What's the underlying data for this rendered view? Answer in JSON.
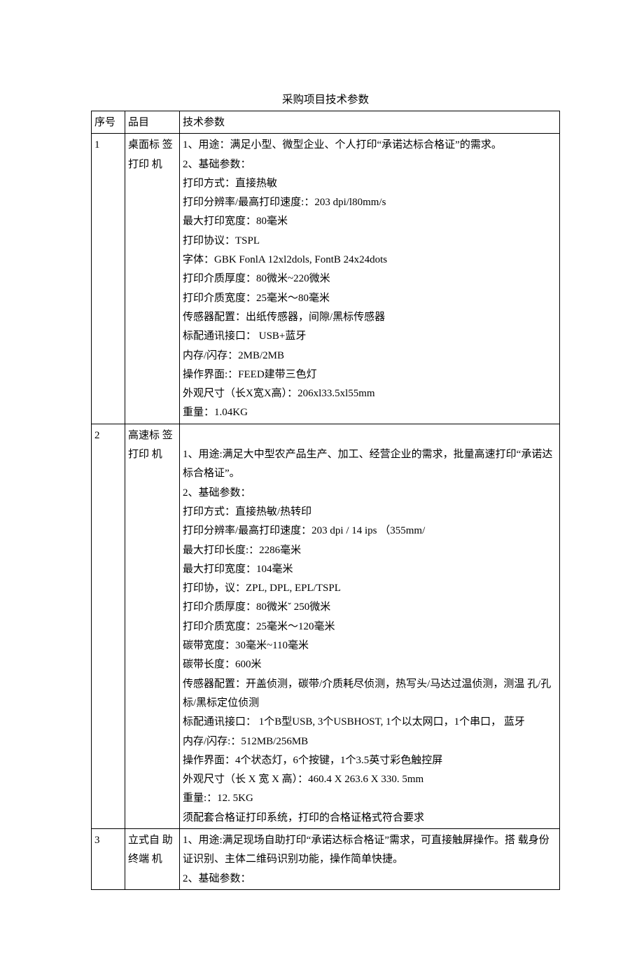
{
  "title": "采购项目技术参数",
  "header": {
    "col1": "序号",
    "col2": "品目",
    "col3": "技术参数"
  },
  "rows": [
    {
      "idx": "1",
      "name": "桌面标 签打印 机",
      "spec": [
        "1、用途：满足小型、微型企业、个人打印“承诺达标合格证”的需求。",
        "2、基础参数：",
        "打印方式：直接热敏",
        "打印分辨率/最高打印速度:：203 dpi/l80mm/s",
        "最大打印宽度：80毫米",
        "打印协议：TSPL",
        "字体：GBK FonlA 12xl2dols, FontB 24x24dots",
        "打印介质厚度：80微米~220微米",
        "打印介质宽度：25毫米～80毫米",
        "传感器配置：出纸传感器，间隙/黑标传感器",
        "标配通讯接口： USB+蓝牙",
        "内存/闪存：2MB/2MB",
        "操作界面:：FEED建带三色灯",
        "外观尺寸（长X宽X高）：206xl33.5xl55mm",
        "重量：1.04KG"
      ]
    },
    {
      "idx": "2",
      "name": "高速标 签打印 机",
      "spec": [
        "",
        "1、用途:满足大中型农产品生产、加工、经营企业的需求，批量高速打印“承诺达标合格证”。",
        "2、基础参数：",
        "打印方式：直接热敏/热转印",
        "打印分辨率/最高打印速度：203 dpi / 14 ips （355mm/",
        "最大打印长度:：2286毫米",
        "最大打印宽度：104毫米",
        "打印协，议：ZPL, DPL, EPL/TSPL",
        "打印介质厚度：80微米ˇ 250微米",
        "打印介质宽度：25毫米～120毫米",
        "碳带宽度：30毫米~110毫米",
        "碳带长度：600米",
        "传感器配置：开盖侦测，碳带/介质耗尽侦测，热写头/马达过温侦测，测温 孔/孔标/黑标定位侦测",
        "标配通讯接口：  1个B型USB, 3个USBHOST, 1个以太网口，1个串口，   蓝牙",
        "内存/闪存:：512MB/256MB",
        "操作界面：4个状态灯，6个按键，1个3.5英寸彩色触控屏",
        "外观尺寸（长 X 宽 X 高）：460.4 X 263.6 X 330. 5mm",
        "重量:：12. 5KG",
        "须配套合格证打印系统，打印的合格证格式符合要求"
      ]
    },
    {
      "idx": "3",
      "name": "立式自 助终端 机",
      "spec": [
        "1、用途:满足现场自助打印“承诺达标合格证”需求，可直接触屏操作。搭 载身份证识别、主体二维码识别功能，操作简单快捷。",
        "2、基础参数："
      ]
    }
  ]
}
